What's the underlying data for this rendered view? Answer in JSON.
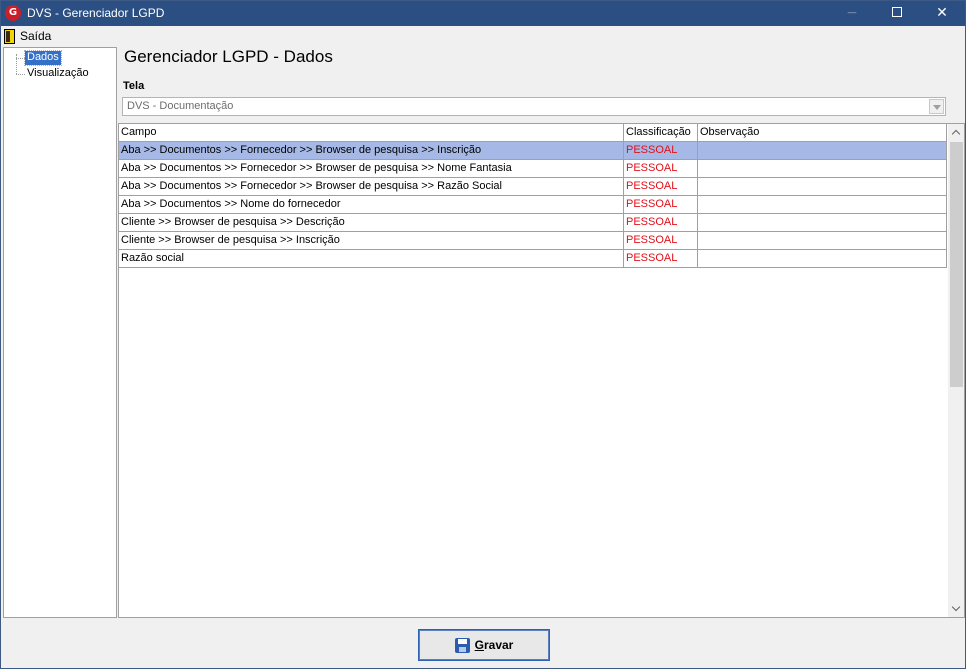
{
  "window": {
    "title": "DVS - Gerenciador LGPD",
    "app_icon": "dvs-logo-icon",
    "controls": {
      "minimize": "−",
      "close": "✕"
    }
  },
  "menu": {
    "exit_label": "Saída",
    "exit_icon": "door-exit-icon"
  },
  "sidebar": {
    "items": [
      {
        "label": "Dados",
        "selected": true
      },
      {
        "label": "Visualização",
        "selected": false
      }
    ]
  },
  "main": {
    "title": "Gerenciador LGPD - Dados",
    "tela_label": "Tela",
    "tela_value": "DVS - Documentação"
  },
  "grid": {
    "columns": [
      "Campo",
      "Classificação",
      "Observação"
    ],
    "rows": [
      {
        "campo": "Aba >> Documentos  >> Fornecedor >> Browser de pesquisa >> Inscrição",
        "classificacao": "PESSOAL",
        "observacao": ""
      },
      {
        "campo": "Aba >> Documentos  >> Fornecedor >> Browser de pesquisa >> Nome Fantasia",
        "classificacao": "PESSOAL",
        "observacao": ""
      },
      {
        "campo": "Aba >> Documentos  >> Fornecedor >> Browser de pesquisa >> Razão Social",
        "classificacao": "PESSOAL",
        "observacao": ""
      },
      {
        "campo": "Aba >> Documentos  >> Nome do fornecedor",
        "classificacao": "PESSOAL",
        "observacao": ""
      },
      {
        "campo": "Cliente >> Browser de pesquisa >> Descrição",
        "classificacao": "PESSOAL",
        "observacao": ""
      },
      {
        "campo": "Cliente >> Browser de pesquisa >> Inscrição",
        "classificacao": "PESSOAL",
        "observacao": ""
      },
      {
        "campo": "Razão social",
        "classificacao": "PESSOAL",
        "observacao": ""
      }
    ],
    "selected_row": 0
  },
  "footer": {
    "save_label": "Gravar",
    "save_icon": "floppy-disk-icon"
  },
  "colors": {
    "titlebar": "#2b4f82",
    "selection": "#a5b8e6",
    "classification_text": "#e0101a",
    "tree_selection": "#3570c8"
  }
}
